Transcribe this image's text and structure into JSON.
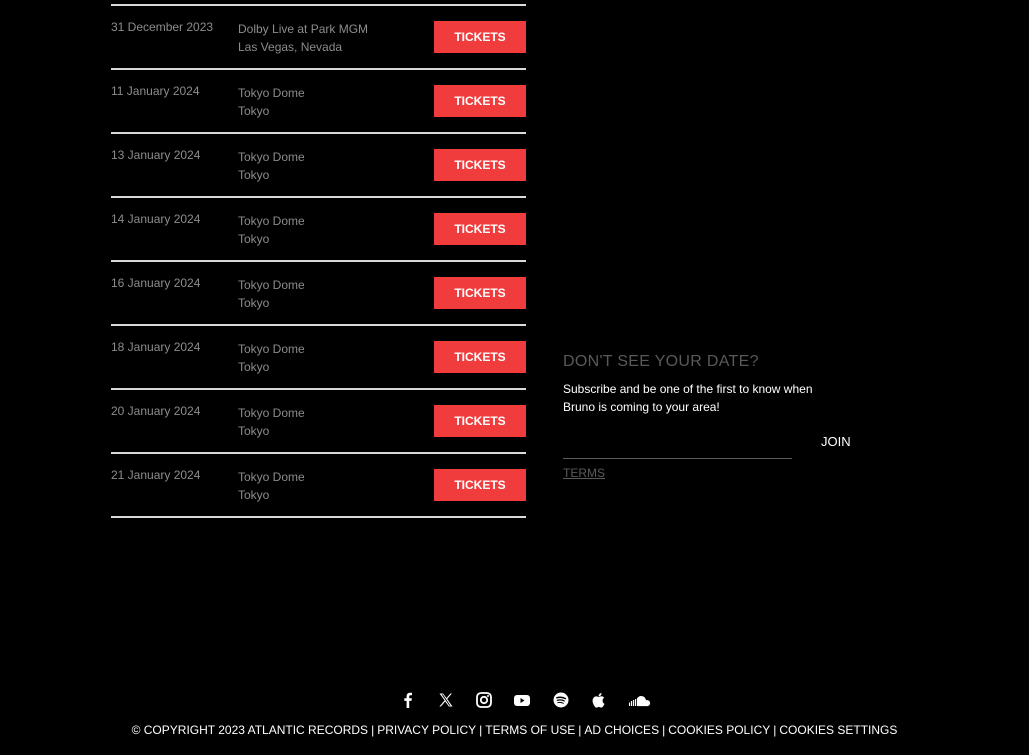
{
  "tour": {
    "ticket_label": "TICKETS",
    "dates": [
      {
        "date": "31 December 2023",
        "venue": "Dolby Live at Park MGM",
        "city": "Las Vegas, Nevada"
      },
      {
        "date": "11 January 2024",
        "venue": "Tokyo Dome",
        "city": "Tokyo"
      },
      {
        "date": "13 January 2024",
        "venue": "Tokyo Dome",
        "city": "Tokyo"
      },
      {
        "date": "14 January 2024",
        "venue": "Tokyo Dome",
        "city": "Tokyo"
      },
      {
        "date": "16 January 2024",
        "venue": "Tokyo Dome",
        "city": "Tokyo"
      },
      {
        "date": "18 January 2024",
        "venue": "Tokyo Dome",
        "city": "Tokyo"
      },
      {
        "date": "20 January 2024",
        "venue": "Tokyo Dome",
        "city": "Tokyo"
      },
      {
        "date": "21 January 2024",
        "venue": "Tokyo Dome",
        "city": "Tokyo"
      }
    ]
  },
  "subscribe": {
    "heading": "DON'T SEE YOUR DATE?",
    "text": "Subscribe and be one of the first to know when Bruno is coming to your area!",
    "email_placeholder": "",
    "join_label": "JOIN",
    "terms_label": "TERMS"
  },
  "social": {
    "icons": [
      "facebook-icon",
      "x-icon",
      "instagram-icon",
      "youtube-icon",
      "spotify-icon",
      "apple-icon",
      "soundcloud-icon"
    ]
  },
  "footer": {
    "copyright": "© COPYRIGHT 2023 ATLANTIC RECORDS",
    "links": [
      "PRIVACY POLICY",
      "TERMS OF USE",
      "AD CHOICES",
      "COOKIES POLICY",
      "COOKIES SETTINGS"
    ]
  },
  "colors": {
    "background": "#000000",
    "accent": "#f03c3c",
    "muted_text": "#8c8c8c",
    "divider": "#d9d9d9"
  }
}
